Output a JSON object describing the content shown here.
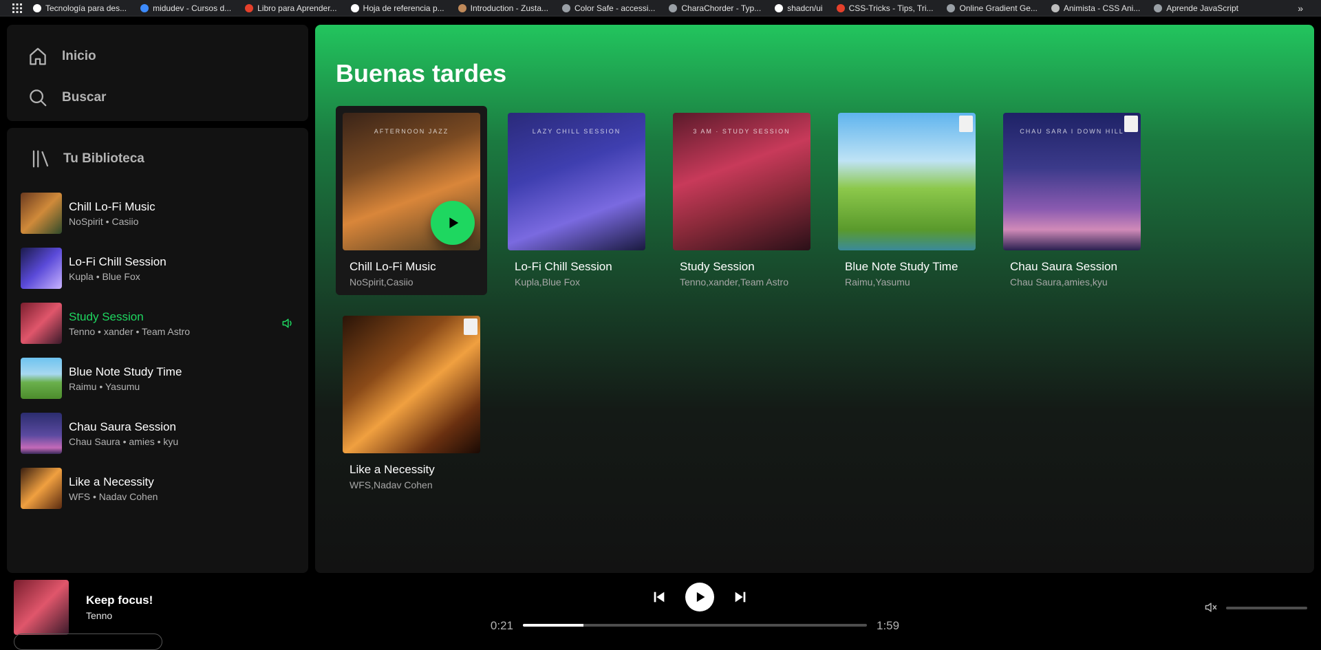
{
  "bookmarks": {
    "items": [
      {
        "label": "Tecnología para des...",
        "color": "#ffffff"
      },
      {
        "label": "midudev - Cursos d...",
        "color": "#3d8bfd"
      },
      {
        "label": "Libro para Aprender...",
        "color": "#e5402b"
      },
      {
        "label": "Hoja de referencia p...",
        "color": "#ffffff"
      },
      {
        "label": "Introduction - Zusta...",
        "color": "#c08a5a"
      },
      {
        "label": "Color Safe - accessi...",
        "color": "#9aa0a6"
      },
      {
        "label": "CharaChorder - Typ...",
        "color": "#9aa0a6"
      },
      {
        "label": "shadcn/ui",
        "color": "#ffffff"
      },
      {
        "label": "CSS-Tricks - Tips, Tri...",
        "color": "#e5402b"
      },
      {
        "label": "Online Gradient Ge...",
        "color": "#9aa0a6"
      },
      {
        "label": "Animista - CSS Ani...",
        "color": "#bdbdbd"
      },
      {
        "label": "Aprende JavaScript",
        "color": "#9aa0a6"
      }
    ],
    "more_icon": "double-chevron-right-icon"
  },
  "nav": {
    "home_label": "Inicio",
    "search_label": "Buscar"
  },
  "library": {
    "title": "Tu Biblioteca",
    "items": [
      {
        "title": "Chill Lo-Fi Music",
        "artists": "NoSpirit • Casiio",
        "active": false,
        "thumb": "linear-gradient(135deg,#6b3a1f,#d08a3a 50%,#2f4a2a)"
      },
      {
        "title": "Lo-Fi Chill Session",
        "artists": "Kupla • Blue Fox",
        "active": false,
        "thumb": "linear-gradient(135deg,#1a1a4a,#5a4ad8 50%,#c9b3ff)"
      },
      {
        "title": "Study Session",
        "artists": "Tenno • xander • Team Astro",
        "active": true,
        "thumb": "linear-gradient(135deg,#7a1e2e,#e0566b 50%,#3a1a2a)"
      },
      {
        "title": "Blue Note Study Time",
        "artists": "Raimu • Yasumu",
        "active": false,
        "thumb": "linear-gradient(180deg,#6ec3f0,#a8d8f0 40%,#6ab04c 60%,#4c8c2c)"
      },
      {
        "title": "Chau Saura Session",
        "artists": "Chau Saura • amies • kyu",
        "active": false,
        "thumb": "linear-gradient(180deg,#2b2d6e,#5b4aa0 55%,#c46ab8 85%,#3a2a5a)"
      },
      {
        "title": "Like a Necessity",
        "artists": "WFS • Nadav Cohen",
        "active": false,
        "thumb": "linear-gradient(135deg,#3a1f10,#f0a040 50%,#5a2a10)"
      }
    ]
  },
  "main": {
    "greeting": "Buenas tardes",
    "cards": [
      {
        "title": "Chill Lo-Fi Music",
        "artists": "NoSpirit,Casiio",
        "cover_text": "AFTERNOON JAZZ",
        "hover": true,
        "sticker": false,
        "cover": "linear-gradient(160deg,#3a2418 0%,#7a4a22 35%,#d9863a 60%,#4b3a20 100%)"
      },
      {
        "title": "Lo-Fi Chill Session",
        "artists": "Kupla,Blue Fox",
        "cover_text": "LAZY CHILL SESSION",
        "hover": false,
        "sticker": false,
        "cover": "linear-gradient(160deg,#2a2a7a 0%,#3f3fb0 40%,#7a6ae0 70%,#1a1a40 100%)"
      },
      {
        "title": "Study Session",
        "artists": "Tenno,xander,Team Astro",
        "cover_text": "3 AM · STUDY SESSION",
        "hover": false,
        "sticker": false,
        "cover": "linear-gradient(160deg,#5a1a2a 0%,#c83a5a 40%,#8a2a3a 65%,#2a1018 100%)"
      },
      {
        "title": "Blue Note Study Time",
        "artists": "Raimu,Yasumu",
        "cover_text": "",
        "hover": false,
        "sticker": true,
        "cover": "linear-gradient(180deg,#5fb4ee 0%,#bfe3f5 35%,#8cc84b 55%,#5a9a2c 85%,#3a8a9a 100%)"
      },
      {
        "title": "Chau Saura Session",
        "artists": "Chau Saura,amies,kyu",
        "cover_text": "CHAU SARA  I DOWN HILL",
        "hover": false,
        "sticker": true,
        "cover": "linear-gradient(180deg,#1e2266 0%,#3b3a8a 40%,#8a5ab0 70%,#d08ab8 85%,#2a2050 100%)"
      },
      {
        "title": "Like a Necessity",
        "artists": "WFS,Nadav Cohen",
        "cover_text": "",
        "hover": false,
        "sticker": true,
        "cover": "linear-gradient(140deg,#2a1408 0%,#8a4a18 35%,#f0a040 55%,#6a3010 80%,#1a0a04 100%)"
      }
    ]
  },
  "player": {
    "track_title": "Keep focus!",
    "track_artist": "Tenno",
    "current_time": "0:21",
    "total_time": "1:59",
    "progress": 0.176,
    "volume_muted": true,
    "thumb": "linear-gradient(135deg,#7a1e2e,#e0566b 50%,#3a1a2a)"
  },
  "colors": {
    "accent": "#1ed760",
    "text_secondary": "#b3b3b3",
    "panel": "#121212"
  }
}
